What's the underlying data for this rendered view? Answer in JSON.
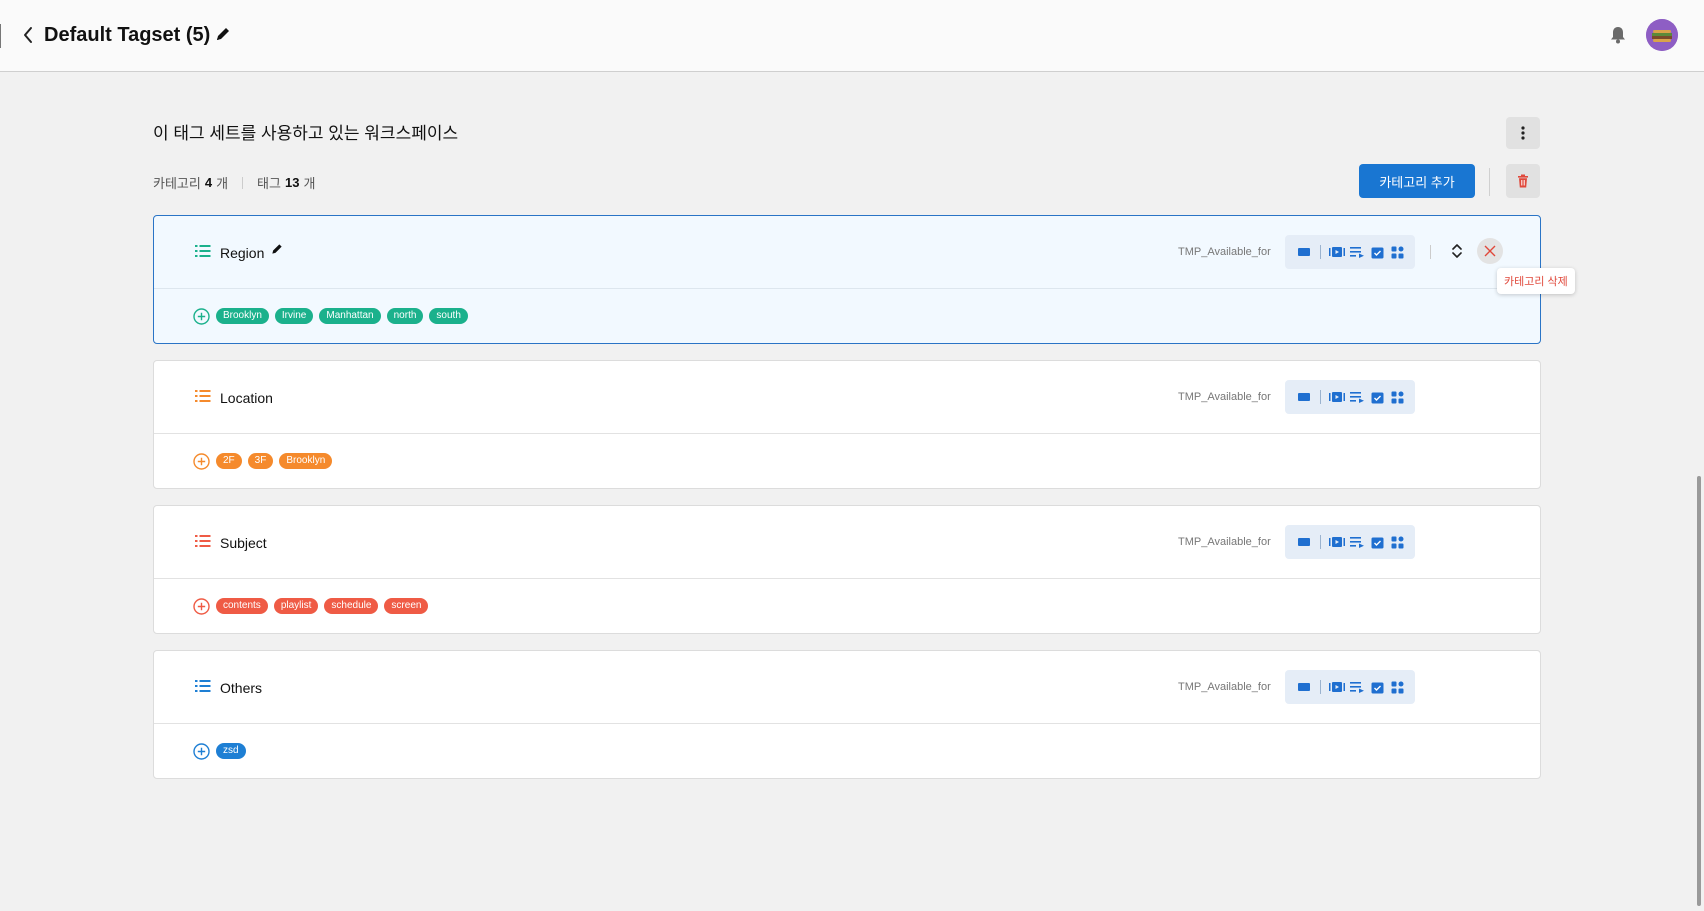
{
  "header": {
    "title": "Default Tagset (5)",
    "back_icon": "chevron-left-icon",
    "edit_icon": "pencil-icon",
    "notification_icon": "bell-icon",
    "avatar_icon": "user-avatar"
  },
  "workspace": {
    "title": "이 태그 세트를 사용하고 있는 워크스페이스",
    "more_icon": "more-vertical-icon"
  },
  "summary": {
    "category_label": "카테고리",
    "category_count": "4",
    "category_unit": "개",
    "tag_label": "태그",
    "tag_count": "13",
    "tag_unit": "개"
  },
  "toolbar": {
    "add_category_label": "카테고리 추가",
    "delete_icon": "trash-icon"
  },
  "categories": [
    {
      "name": "Region",
      "color": "#1bb18c",
      "available_label": "TMP_Available_for",
      "tags": [
        "Brooklyn",
        "Irvine",
        "Manhattan",
        "north",
        "south"
      ],
      "selected": true,
      "delete_tooltip": "카테고리 삭제"
    },
    {
      "name": "Location",
      "color": "#f58a2c",
      "available_label": "TMP_Available_for",
      "tags": [
        "2F",
        "3F",
        "Brooklyn"
      ]
    },
    {
      "name": "Subject",
      "color": "#ef5b45",
      "available_label": "TMP_Available_for",
      "tags": [
        "contents",
        "playlist",
        "schedule",
        "screen"
      ]
    },
    {
      "name": "Others",
      "color": "#1e7fd4",
      "available_label": "TMP_Available_for",
      "tags": [
        "zsd"
      ]
    }
  ],
  "colors": {
    "primary": "#1976d2",
    "icon_blue": "#1f6fd0",
    "danger": "#e0483b"
  }
}
